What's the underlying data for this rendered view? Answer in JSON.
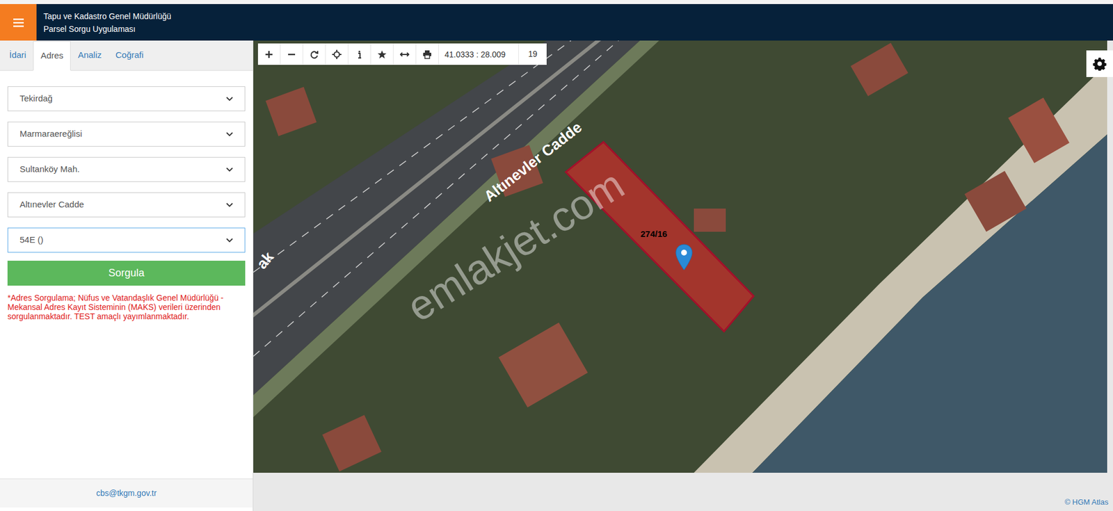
{
  "header": {
    "title": "Tapu ve Kadastro Genel Müdürlüğü",
    "subtitle": "Parsel Sorgu Uygulaması"
  },
  "tabs": [
    {
      "label": "İdari",
      "selected": false
    },
    {
      "label": "Adres",
      "selected": true
    },
    {
      "label": "Analiz",
      "selected": false
    },
    {
      "label": "Coğrafi",
      "selected": false
    }
  ],
  "selects": [
    {
      "value": "Tekirdağ",
      "focused": false
    },
    {
      "value": "Marmaraereğlisi",
      "focused": false
    },
    {
      "value": "Sultanköy Mah.",
      "focused": false
    },
    {
      "value": "Altınevler Cadde",
      "focused": false
    },
    {
      "value": "54E ()",
      "focused": true
    }
  ],
  "button": "Sorgula",
  "note": "*Adres Sorgulama; Nüfus ve Vatandaşlık Genel Müdürlüğü - Mekansal Adres Kayıt Sisteminin (MAKS) verileri üzerinden sorgulanmaktadır. TEST amaçlı yayımlanmaktadır.",
  "footer": "cbs@tkgm.gov.tr",
  "map": {
    "toolbar": {
      "coordinates": "41.0333 : 28.009",
      "zoom": "19"
    },
    "labels": [
      {
        "text": "Altınevler Cadde"
      },
      {
        "text": "ak"
      }
    ],
    "parcel": "274/16",
    "watermark": "emlakjet.com",
    "attribution": "© HGM Atlas"
  }
}
